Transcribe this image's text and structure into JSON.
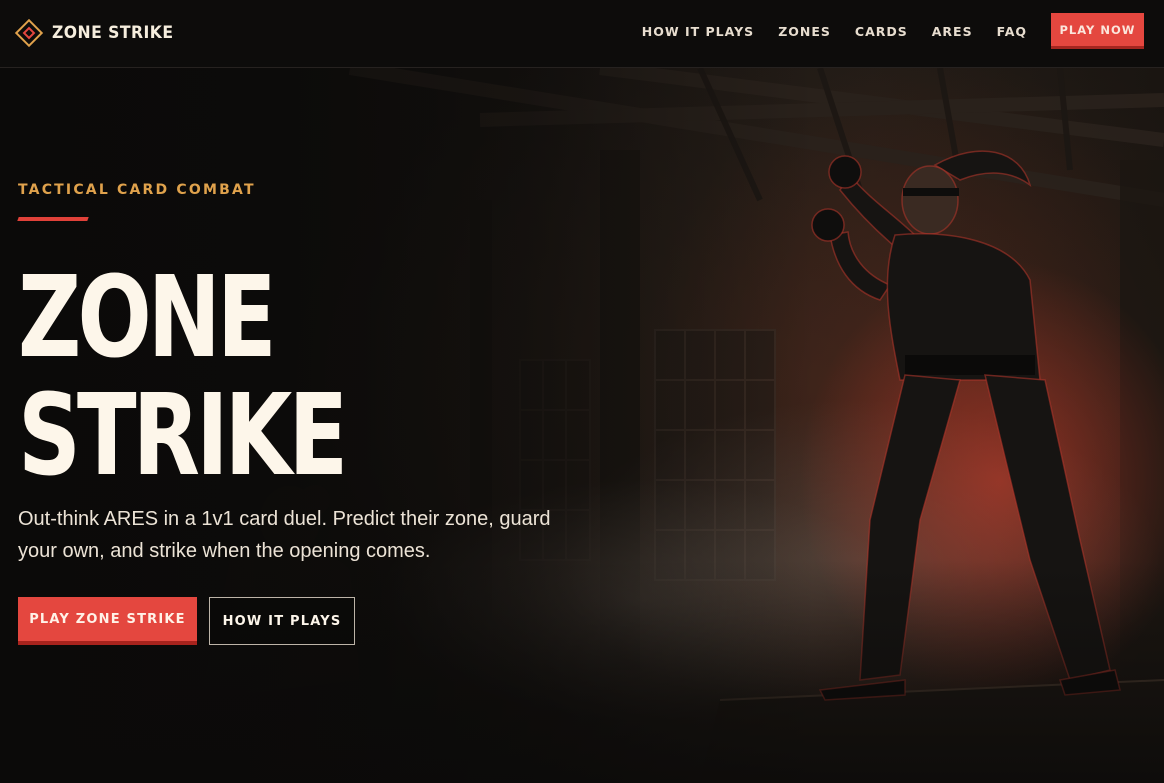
{
  "brand": {
    "name": "ZONE STRIKE",
    "icon": "diamond-logo-icon",
    "accent": "#e4473f",
    "highlight": "#e0a24c"
  },
  "nav": {
    "links": [
      "HOW IT PLAYS",
      "ZONES",
      "CARDS",
      "ARES",
      "FAQ"
    ],
    "cta": "PLAY NOW"
  },
  "hero": {
    "eyebrow": "TACTICAL CARD COMBAT",
    "title_line1": "ZONE",
    "title_line2": "STRIKE",
    "lede": "Out-think ARES in a 1v1 card duel. Predict their zone, guard your own, and strike when the opening comes.",
    "primary_cta": "PLAY ZONE STRIKE",
    "secondary_cta": "HOW IT PLAYS",
    "background_image": "martial-artist-dojo-illustration"
  }
}
